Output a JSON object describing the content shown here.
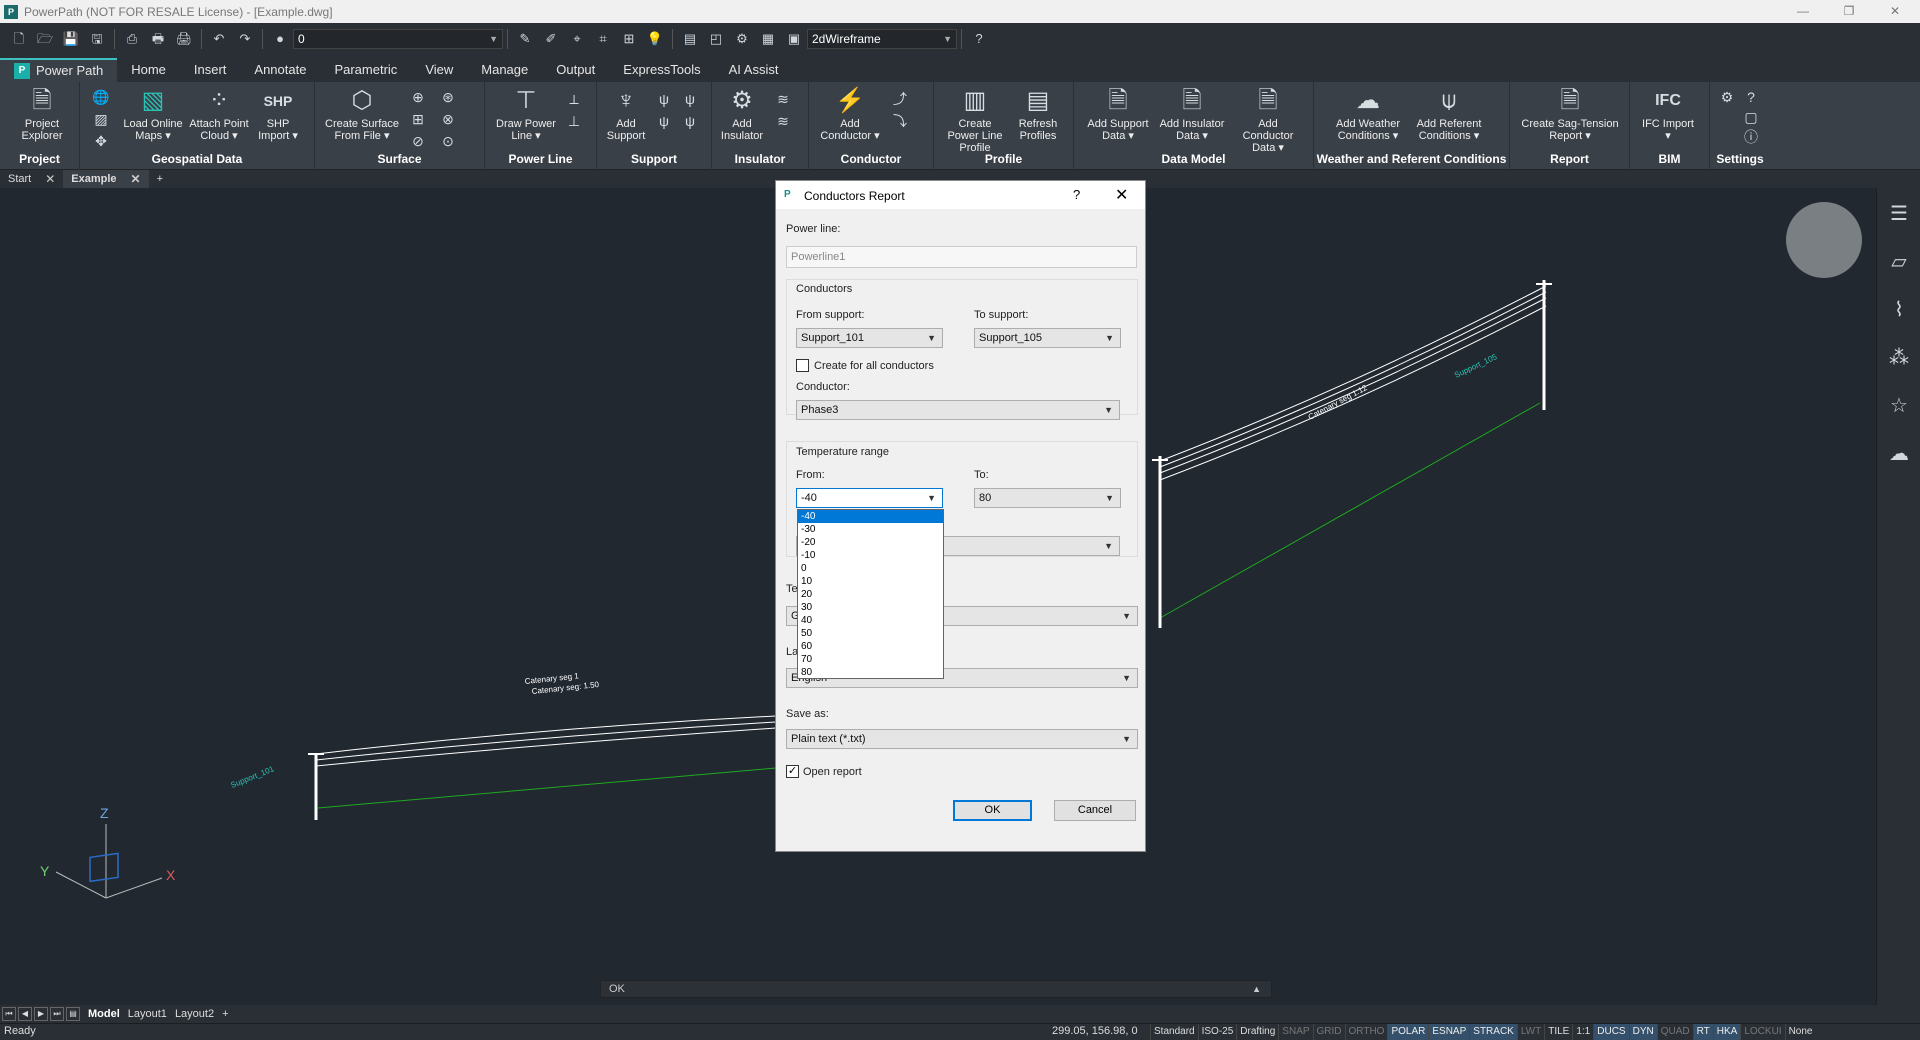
{
  "window": {
    "title": "PowerPath (NOT FOR RESALE License) - [Example.dwg]"
  },
  "qat": {
    "layer": "0",
    "visual_style": "2dWireframe"
  },
  "tabs": [
    "Power Path",
    "Home",
    "Insert",
    "Annotate",
    "Parametric",
    "View",
    "Manage",
    "Output",
    "ExpressTools",
    "AI Assist"
  ],
  "ribbon": {
    "project": {
      "title": "Project",
      "explorer": "Project Explorer"
    },
    "geospatial": {
      "title": "Geospatial Data",
      "load_maps": "Load Online Maps ▾",
      "attach_point": "Attach Point Cloud ▾",
      "shp": "SHP Import ▾",
      "shp_icon_text": "SHP"
    },
    "surface": {
      "title": "Surface",
      "create_surface": "Create Surface From File ▾"
    },
    "powerline": {
      "title": "Power Line",
      "draw": "Draw Power Line ▾"
    },
    "support": {
      "title": "Support",
      "add": "Add Support"
    },
    "insulator": {
      "title": "Insulator",
      "add": "Add Insulator"
    },
    "conductor": {
      "title": "Conductor",
      "add": "Add Conductor ▾"
    },
    "profile": {
      "title": "Profile",
      "create": "Create Power Line Profile",
      "refresh": "Refresh Profiles"
    },
    "datamodel": {
      "title": "Data Model",
      "support": "Add Support Data ▾",
      "insulator": "Add Insulator Data ▾",
      "conductor": "Add Conductor Data ▾"
    },
    "weather": {
      "title": "Weather and Referent Conditions",
      "weather": "Add Weather Conditions ▾",
      "referent": "Add Referent Conditions ▾"
    },
    "report": {
      "title": "Report",
      "sag": "Create Sag-Tension Report ▾"
    },
    "bim": {
      "title": "BIM",
      "ifc": "IFC Import ▾",
      "ifc_icon_text": "IFC"
    },
    "settings": {
      "title": "Settings"
    }
  },
  "doc_tabs": {
    "start": "Start",
    "example": "Example",
    "add": "+"
  },
  "scene_labels": {
    "l1": "Catenary seg 1",
    "l2": "Catenary seg: 1.50",
    "l3": "Support_101",
    "l4": "Support_105",
    "l5": "Catenary seg 1.12"
  },
  "axes": {
    "x": "X",
    "y": "Y",
    "z": "Z"
  },
  "dialog": {
    "title": "Conductors Report",
    "help": "?",
    "close": "✕",
    "power_line_label": "Power line:",
    "power_line_value": "Powerline1",
    "conductors_group": "Conductors",
    "from_support_label": "From support:",
    "from_support_value": "Support_101",
    "to_support_label": "To support:",
    "to_support_value": "Support_105",
    "create_all_label": "Create for all conductors",
    "conductor_label": "Conductor:",
    "conductor_value": "Phase3",
    "temp_group": "Temperature range",
    "from_label": "From:",
    "from_value": "-40",
    "to_label": "To:",
    "to_value": "80",
    "te_partial": "Te",
    "la_partial": "La",
    "g_partial": "G",
    "language_value": "English",
    "save_as_label": "Save as:",
    "save_as_value": "Plain text (*.txt)",
    "open_report_label": "Open report",
    "open_report_mark": "✓",
    "ok": "OK",
    "cancel": "Cancel"
  },
  "dropdown_options": [
    "-40",
    "-30",
    "-20",
    "-10",
    "0",
    "10",
    "20",
    "30",
    "40",
    "50",
    "60",
    "70",
    "80"
  ],
  "command_line": "OK",
  "layouts": {
    "model": "Model",
    "l1": "Layout1",
    "l2": "Layout2",
    "add": "+"
  },
  "status": {
    "ready": "Ready",
    "coords": "299.05, 156.98, 0",
    "items": [
      {
        "t": "Standard",
        "s": "plain"
      },
      {
        "t": "ISO-25",
        "s": "plain"
      },
      {
        "t": "Drafting",
        "s": "plain"
      },
      {
        "t": "SNAP",
        "s": "off"
      },
      {
        "t": "GRID",
        "s": "off"
      },
      {
        "t": "ORTHO",
        "s": "off"
      },
      {
        "t": "POLAR",
        "s": "on"
      },
      {
        "t": "ESNAP",
        "s": "on"
      },
      {
        "t": "STRACK",
        "s": "on"
      },
      {
        "t": "LWT",
        "s": "off"
      },
      {
        "t": "TILE",
        "s": "plain"
      },
      {
        "t": "1:1",
        "s": "plain"
      },
      {
        "t": "DUCS",
        "s": "on"
      },
      {
        "t": "DYN",
        "s": "on"
      },
      {
        "t": "QUAD",
        "s": "off"
      },
      {
        "t": "RT",
        "s": "on"
      },
      {
        "t": "HKA",
        "s": "on"
      },
      {
        "t": "LOCKUI",
        "s": "off"
      },
      {
        "t": "None",
        "s": "plain"
      }
    ]
  },
  "colors": {
    "accent": "#2bc2b6",
    "canvas": "#212830",
    "selection": "#0078d7",
    "green_line": "#1faa1f"
  }
}
